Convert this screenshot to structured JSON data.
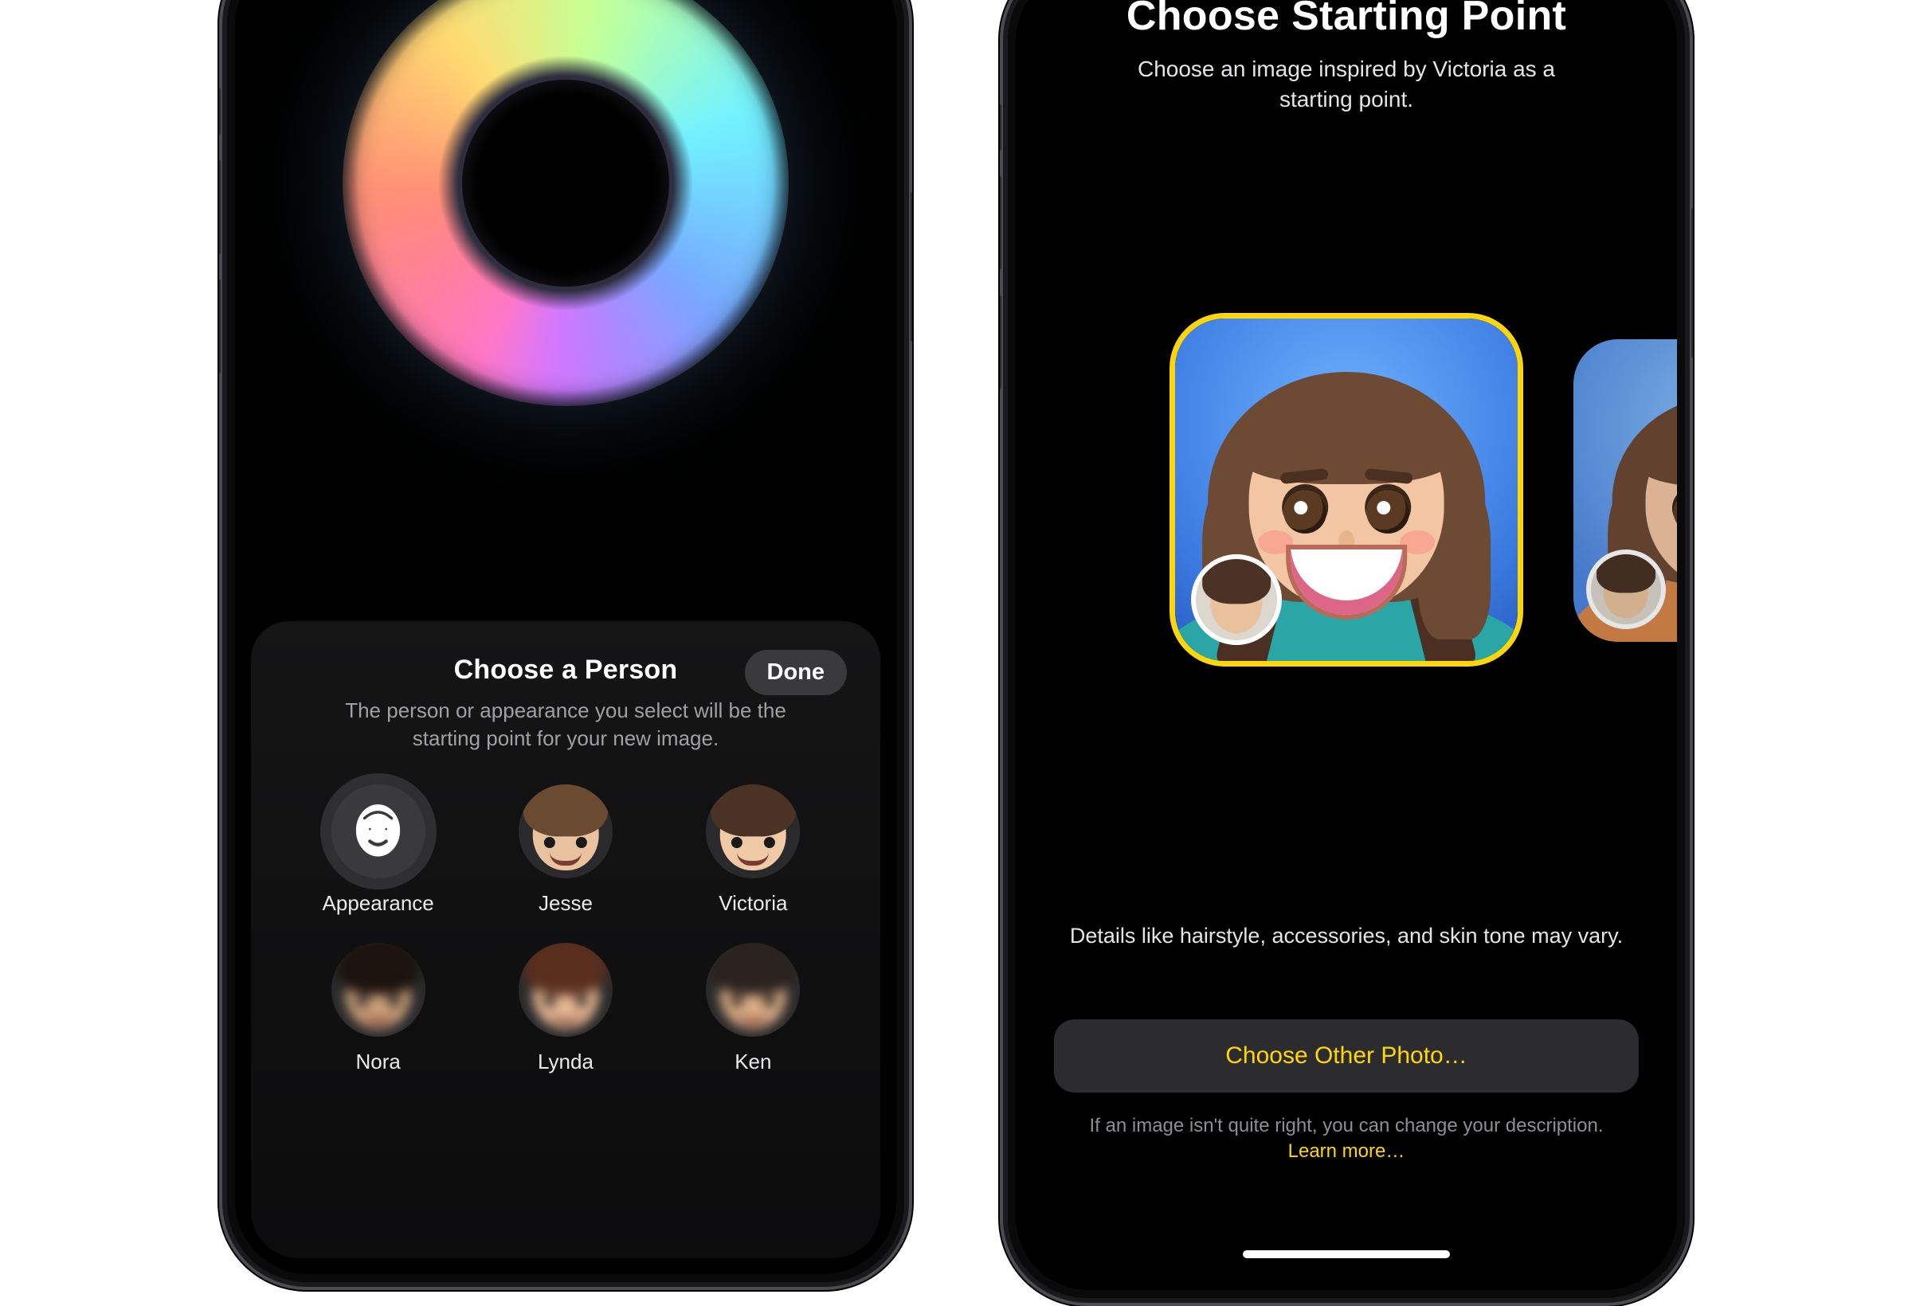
{
  "left": {
    "sheet": {
      "title": "Choose a Person",
      "done": "Done",
      "subtitle": "The person or appearance you select will be the starting point for your new image."
    },
    "people": [
      {
        "label": "Appearance",
        "kind": "glyph"
      },
      {
        "label": "Jesse",
        "kind": "photo",
        "skin": "#e9c2a0",
        "hair": "#6b4a32"
      },
      {
        "label": "Victoria",
        "kind": "photo",
        "skin": "#f0c9a6",
        "hair": "#4a3324"
      },
      {
        "label": "Nora",
        "kind": "photo-blur",
        "skin": "#caa07a",
        "hair": "#1d1410"
      },
      {
        "label": "Lynda",
        "kind": "photo-blur",
        "skin": "#e6b995",
        "hair": "#5a2f1e"
      },
      {
        "label": "Ken",
        "kind": "photo-blur",
        "skin": "#dcae86",
        "hair": "#2a2320"
      }
    ]
  },
  "right": {
    "title": "Choose Starting Point",
    "subtitle": "Choose an image inspired by Victoria as a starting point.",
    "disclaimer": "Details like hairstyle, accessories, and skin tone may vary.",
    "choose_other": "Choose Other Photo…",
    "footnote_a": "If an image isn't quite right, you can change your",
    "footnote_b": "description.",
    "footnote_more": "Learn more…"
  },
  "colors": {
    "accent_yellow": "#ffd60a"
  }
}
